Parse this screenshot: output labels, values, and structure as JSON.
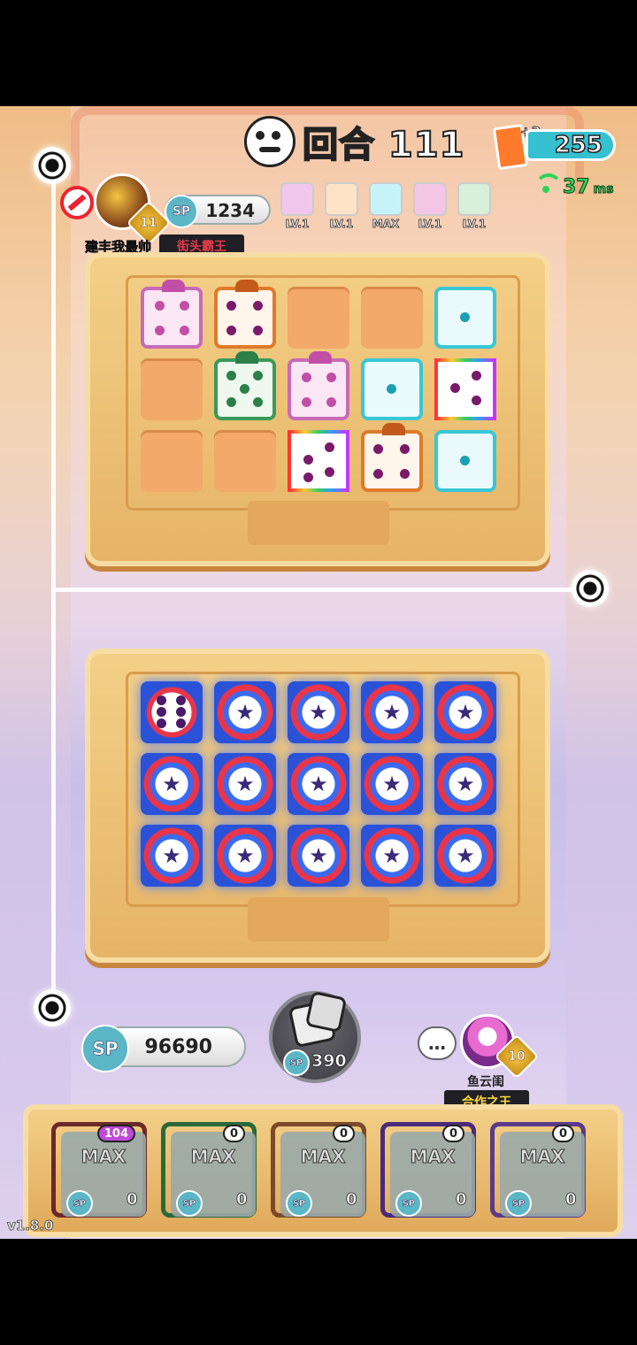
{
  "hud": {
    "round_label": "回合 111",
    "card_plus": "+3",
    "card_count": "255",
    "ping_value": "37",
    "ping_unit": "ms"
  },
  "opponent": {
    "rank": "11",
    "sp_label": "SP",
    "sp": "1234",
    "name": "建丰我最帅",
    "title": "街头霸王",
    "deck": [
      {
        "level": "LV.1",
        "color": "#f1c6ec"
      },
      {
        "level": "LV.1",
        "color": "#ffe3c6"
      },
      {
        "level": "MAX",
        "color": "#c6f3f8"
      },
      {
        "level": "LV.1",
        "color": "#f3c6e6"
      },
      {
        "level": "LV.1",
        "color": "#d8efd9"
      }
    ]
  },
  "player": {
    "sp_label": "SP",
    "sp": "96690",
    "roll_cost": "390",
    "chat_icon": "…",
    "rank": "10",
    "name": "鱼云闺",
    "title": "合作之王",
    "deck": [
      {
        "max": "MAX",
        "count": "104",
        "cost": "0",
        "color": "#6a2a2a"
      },
      {
        "max": "MAX",
        "count": "0",
        "cost": "0",
        "color": "#2a6a3a"
      },
      {
        "max": "MAX",
        "count": "0",
        "cost": "0",
        "color": "#7a4a2a"
      },
      {
        "max": "MAX",
        "count": "0",
        "cost": "0",
        "color": "#4a2a7a"
      },
      {
        "max": "MAX",
        "count": "0",
        "cost": "0",
        "color": "#5a3a8a"
      }
    ]
  },
  "version": "v1.8.0",
  "colors": {
    "accent_cyan": "#37c0d0",
    "title_red": "#e53a4a",
    "title_gold": "#ffd93a"
  }
}
